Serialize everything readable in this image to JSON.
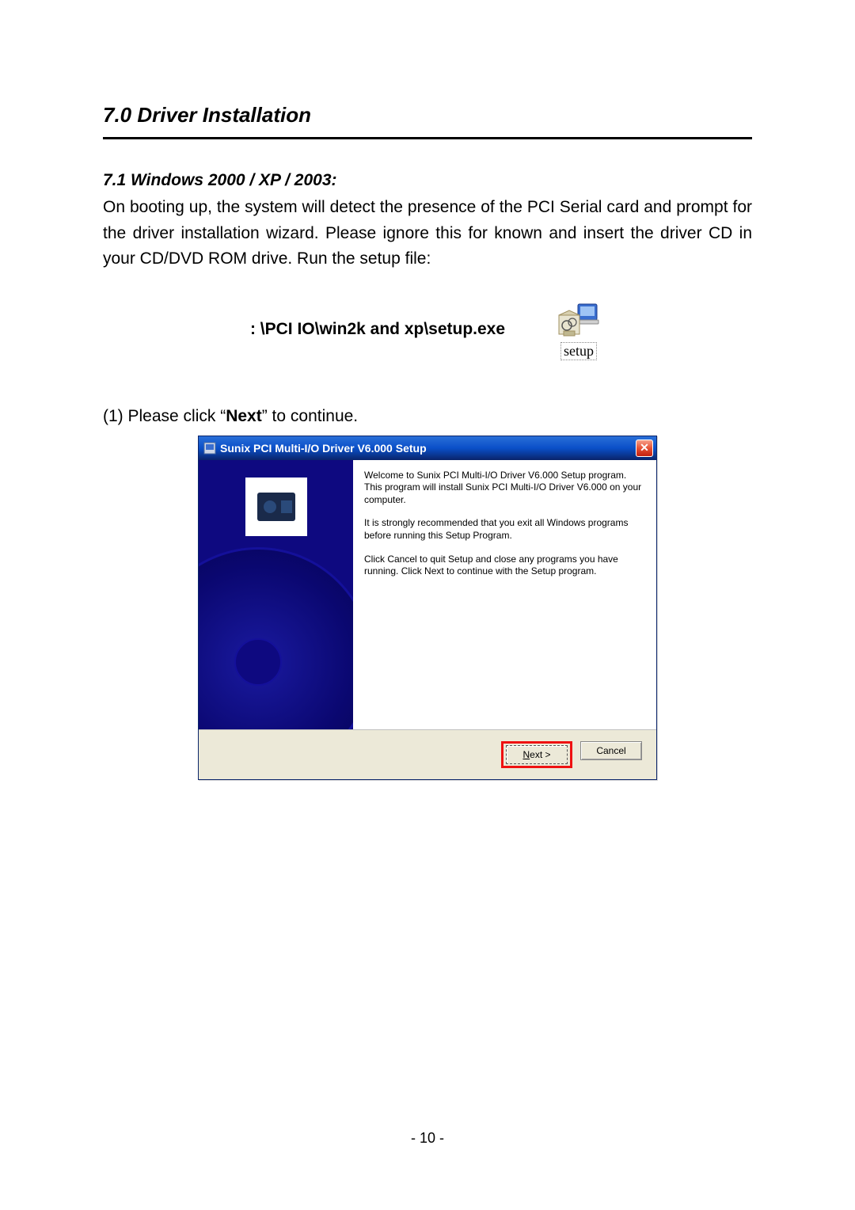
{
  "heading": "7.0 Driver Installation",
  "subheading": "7.1 Windows 2000 / XP / 2003:",
  "body_text": "On booting up, the system will detect the presence of the PCI Serial card and prompt for the driver installation wizard. Please ignore this for known and insert the driver CD in your CD/DVD ROM drive. Run the setup file:",
  "setup_path": ": \\PCI IO\\win2k and xp\\setup.exe",
  "setup_icon_label": "setup",
  "instruction_prefix": "(1) Please click “",
  "instruction_bold": "Next",
  "instruction_suffix": "” to continue.",
  "dialog": {
    "title": "Sunix PCI Multi-I/O Driver V6.000 Setup",
    "p1": "Welcome to Sunix PCI Multi-I/O Driver V6.000 Setup program. This program will install Sunix PCI Multi-I/O Driver V6.000 on your computer.",
    "p2": "It is strongly recommended that you exit all Windows programs before running this Setup Program.",
    "p3": "Click Cancel to quit Setup and close any programs you have running.  Click Next to continue with the Setup program.",
    "next_label_u": "N",
    "next_label_rest": "ext >",
    "cancel_label": "Cancel",
    "close_label": "✕"
  },
  "page_number": "- 10 -"
}
